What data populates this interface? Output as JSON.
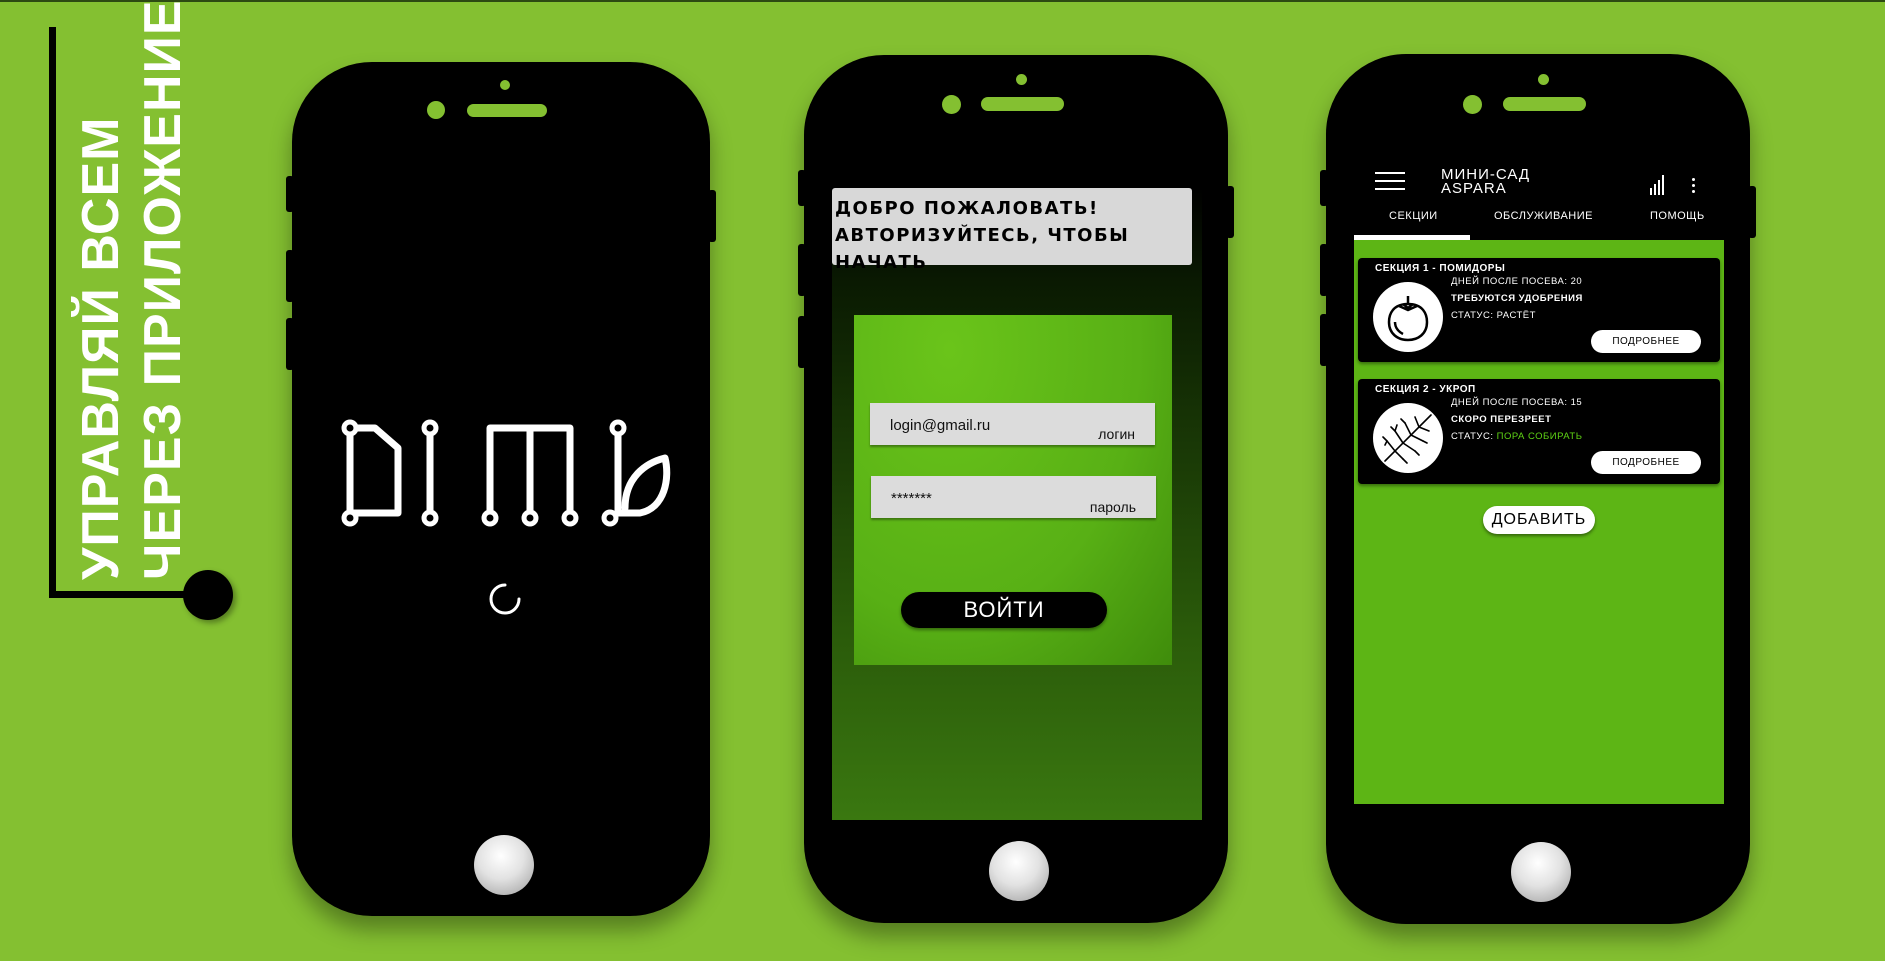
{
  "slogan": {
    "line1": "УПРАВЛЯЙ ВСЕМ",
    "line2": "ЧЕРЕЗ ПРИЛОЖЕНИЕ"
  },
  "splash": {
    "logo_text": "DIMA"
  },
  "login": {
    "welcome_line1": "ДОБРО ПОЖАЛОВАТЬ!",
    "welcome_line2": "АВТОРИЗУЙТЕСЬ, ЧТОБЫ НАЧАТЬ",
    "login_value": "login@gmail.ru",
    "login_label": "логин",
    "password_value": "*******",
    "password_label": "пароль",
    "submit_label": "ВОЙТИ"
  },
  "app": {
    "title_line1": "МИНИ-САД",
    "title_line2": "ASPARA",
    "tabs": [
      {
        "label": "СЕКЦИИ",
        "active": true
      },
      {
        "label": "ОБСЛУЖИВАНИЕ",
        "active": false
      },
      {
        "label": "ПОМОЩЬ",
        "active": false
      }
    ],
    "sections": [
      {
        "title": "СЕКЦИЯ 1 - ПОМИДОРЫ",
        "days_label": "ДНЕЙ ПОСЛЕ ПОСЕВА:",
        "days_value": "20",
        "alert": "ТРЕБУЮТСЯ УДОБРЕНИЯ",
        "status_label": "СТАТУС:",
        "status_value": "РАСТЁТ",
        "status_color": "#ffffff",
        "icon": "tomato-icon",
        "more_label": "ПОДРОБНЕЕ"
      },
      {
        "title": "СЕКЦИЯ 2 - УКРОП",
        "days_label": "ДНЕЙ ПОСЛЕ ПОСЕВА:",
        "days_value": "15",
        "alert": "СКОРО ПЕРЕЗРЕЕТ",
        "status_label": "СТАТУС:",
        "status_value": "ПОРА СОБИРАТЬ",
        "status_color": "#5fd315",
        "icon": "dill-icon",
        "more_label": "ПОДРОБНЕЕ"
      }
    ],
    "add_label": "ДОБАВИТЬ"
  },
  "colors": {
    "background": "#84c031",
    "accent": "#5db515",
    "phone": "#000000"
  }
}
